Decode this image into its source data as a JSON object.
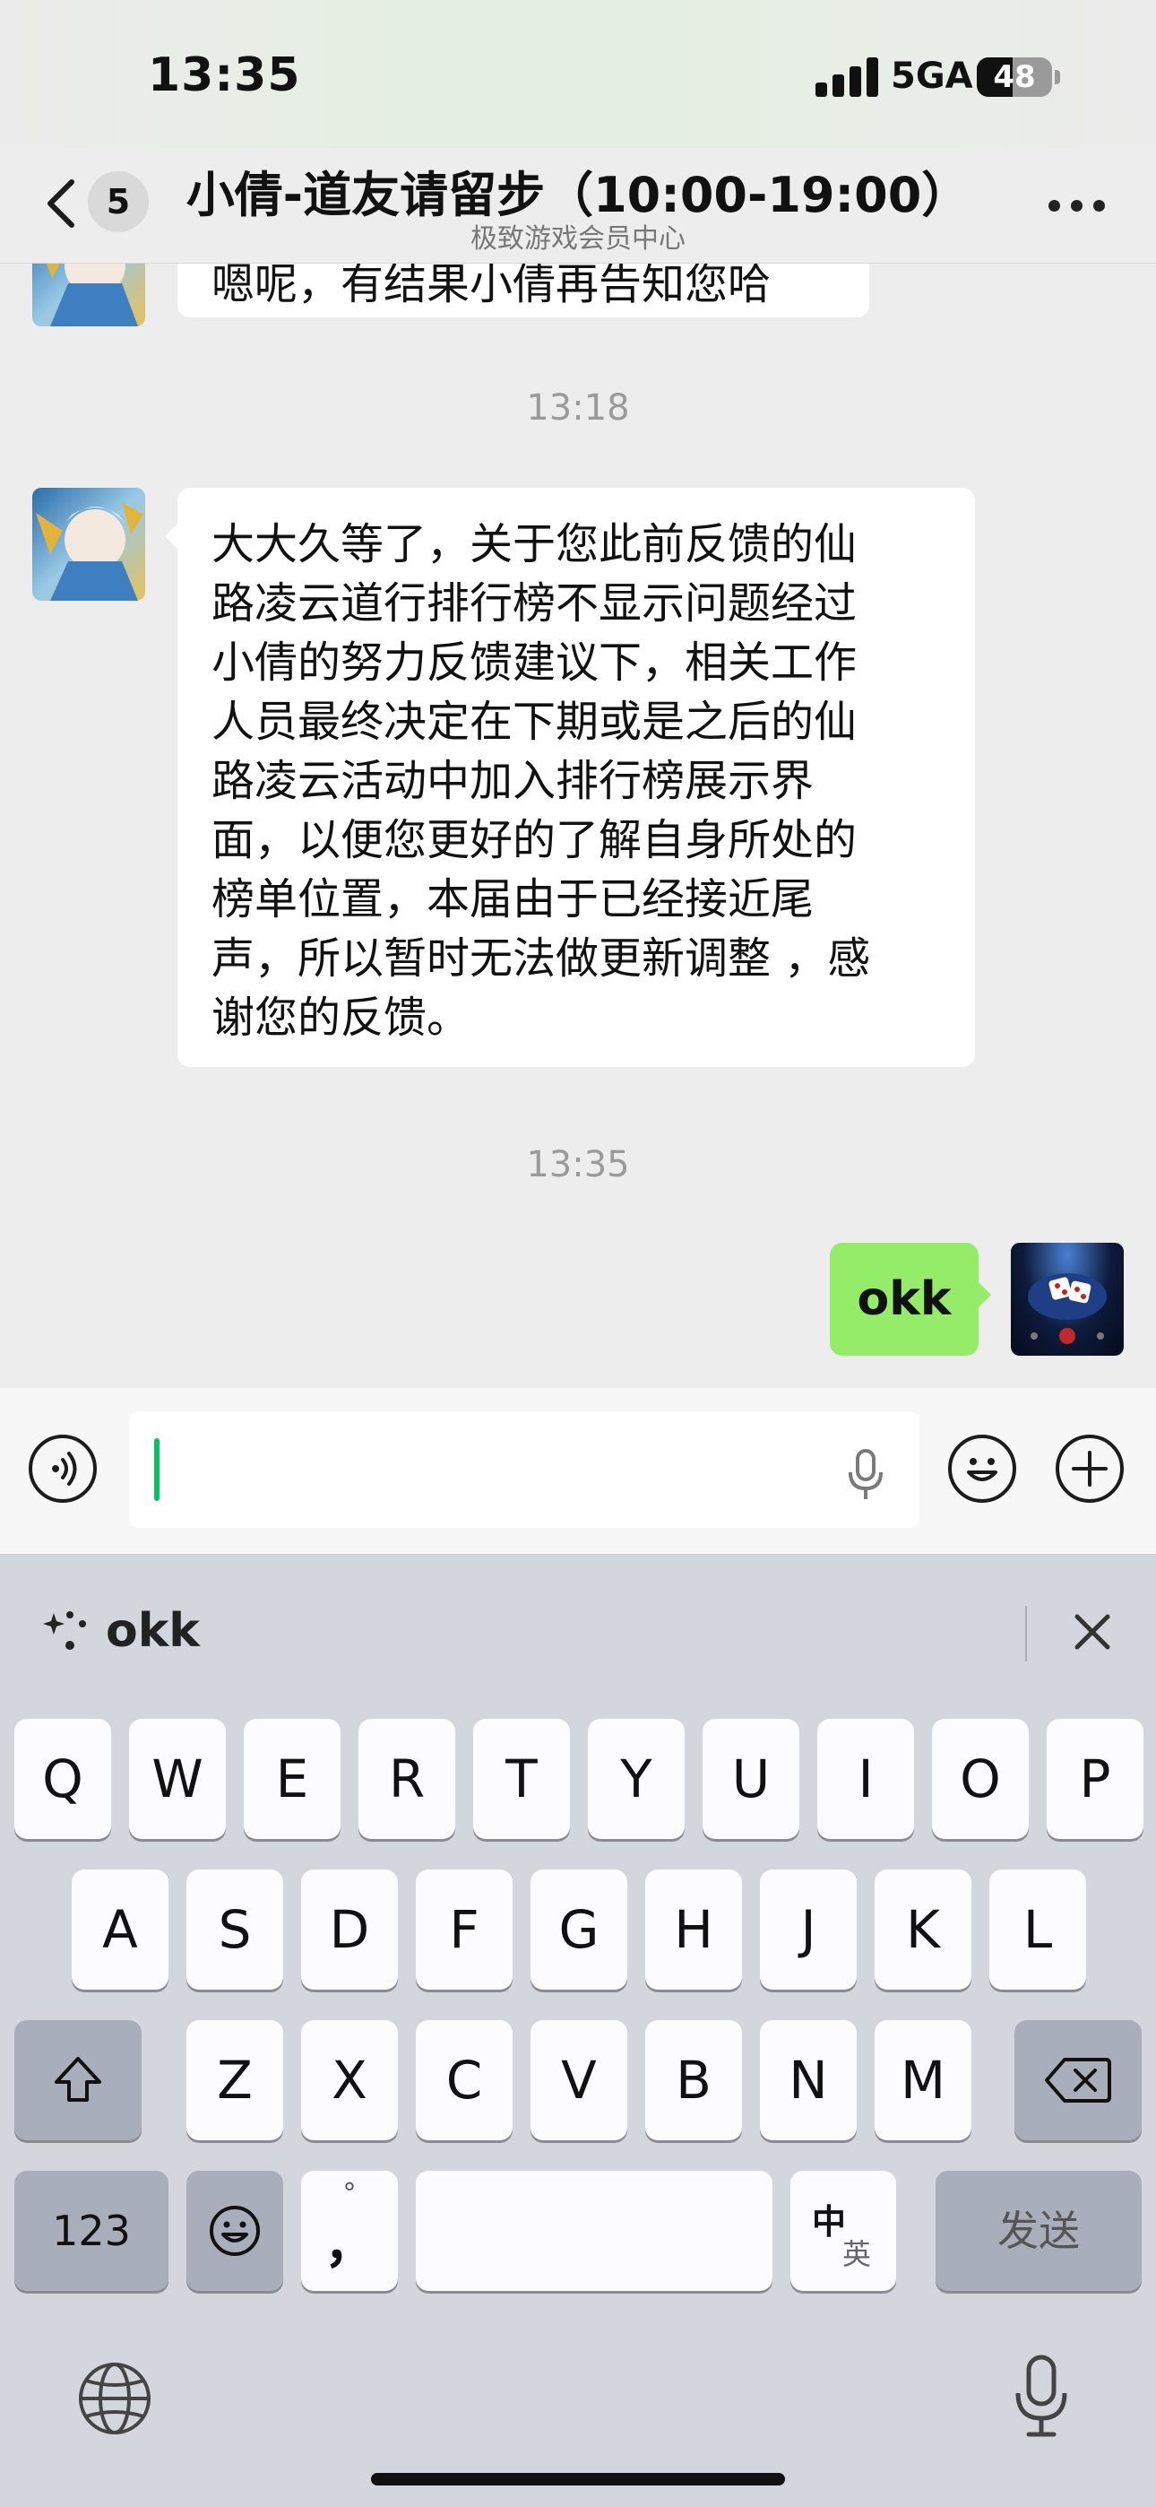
{
  "status_bar": {
    "time": "13:35",
    "network": "5GA",
    "battery": "48"
  },
  "header": {
    "unread_count": "5",
    "title": "小倩-道友请留步（10:00-19:00）",
    "subtitle": "极致游戏会员中心"
  },
  "messages": {
    "partial_top_text": "嗯呢，有结果小倩再告知您哈",
    "timestamp_1": "13:18",
    "message_1_lines": [
      "大大久等了，关于您此前反馈的仙",
      "路凌云道行排行榜不显示问题经过",
      "小倩的努力反馈建议下，相关工作",
      "人员最终决定在下期或是之后的仙",
      "路凌云活动中加入排行榜展示界",
      "面，以便您更好的了解自身所处的",
      "榜单位置，本届由于已经接近尾",
      "声，所以暂时无法做更新调整 ，感",
      "谢您的反馈。"
    ],
    "timestamp_2": "13:35",
    "sent_text": "okk"
  },
  "input_bar": {
    "value": ""
  },
  "keyboard": {
    "suggestion": "okk",
    "row1": [
      "Q",
      "W",
      "E",
      "R",
      "T",
      "Y",
      "U",
      "I",
      "O",
      "P"
    ],
    "row2": [
      "A",
      "S",
      "D",
      "F",
      "G",
      "H",
      "J",
      "K",
      "L"
    ],
    "row3": [
      "Z",
      "X",
      "C",
      "V",
      "B",
      "N",
      "M"
    ],
    "numbers_key": "123",
    "punct_key_top": "°",
    "punct_key_main": "，",
    "lang_key_top": "中",
    "lang_key_bottom": "英",
    "send_key": "发送"
  },
  "colors": {
    "self_bubble": "#95ec69",
    "caret": "#07c160"
  }
}
